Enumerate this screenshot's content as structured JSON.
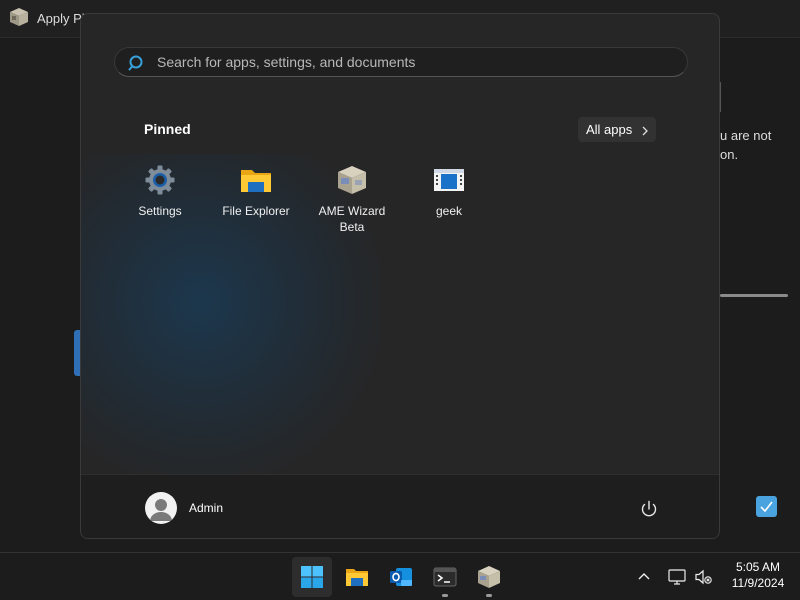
{
  "background_window": {
    "title": "Apply Pl",
    "body_line1": "u are not",
    "body_line2": "on."
  },
  "start_menu": {
    "search": {
      "placeholder": "Search for apps, settings, and documents",
      "value": ""
    },
    "pinned_label": "Pinned",
    "all_apps_label": "All apps",
    "pinned_apps": [
      {
        "label": "Settings",
        "icon": "settings-gear-icon"
      },
      {
        "label": "File Explorer",
        "icon": "folder-icon"
      },
      {
        "label": "AME Wizard Beta",
        "icon": "ame-wizard-box-icon"
      },
      {
        "label": "geek",
        "icon": "geek-app-icon"
      }
    ],
    "user": {
      "name": "Admin",
      "icon": "user-avatar-icon"
    },
    "power_icon": "power-icon"
  },
  "taskbar": {
    "apps": [
      {
        "name": "Start",
        "icon": "windows-start-icon",
        "active": true
      },
      {
        "name": "File Explorer",
        "icon": "folder-icon",
        "active": false
      },
      {
        "name": "Outlook (new)",
        "icon": "outlook-new-icon",
        "active": false
      },
      {
        "name": "Terminal",
        "icon": "terminal-icon",
        "active": false,
        "running": true
      },
      {
        "name": "AME Wizard",
        "icon": "ame-wizard-box-icon",
        "active": false,
        "running": true
      }
    ],
    "tray": {
      "time": "5:05 AM",
      "date": "11/9/2024"
    }
  },
  "colors": {
    "start_bg": "#262626",
    "accent_blue": "#4aa3df",
    "taskbar_bg": "#1c1c1c"
  }
}
